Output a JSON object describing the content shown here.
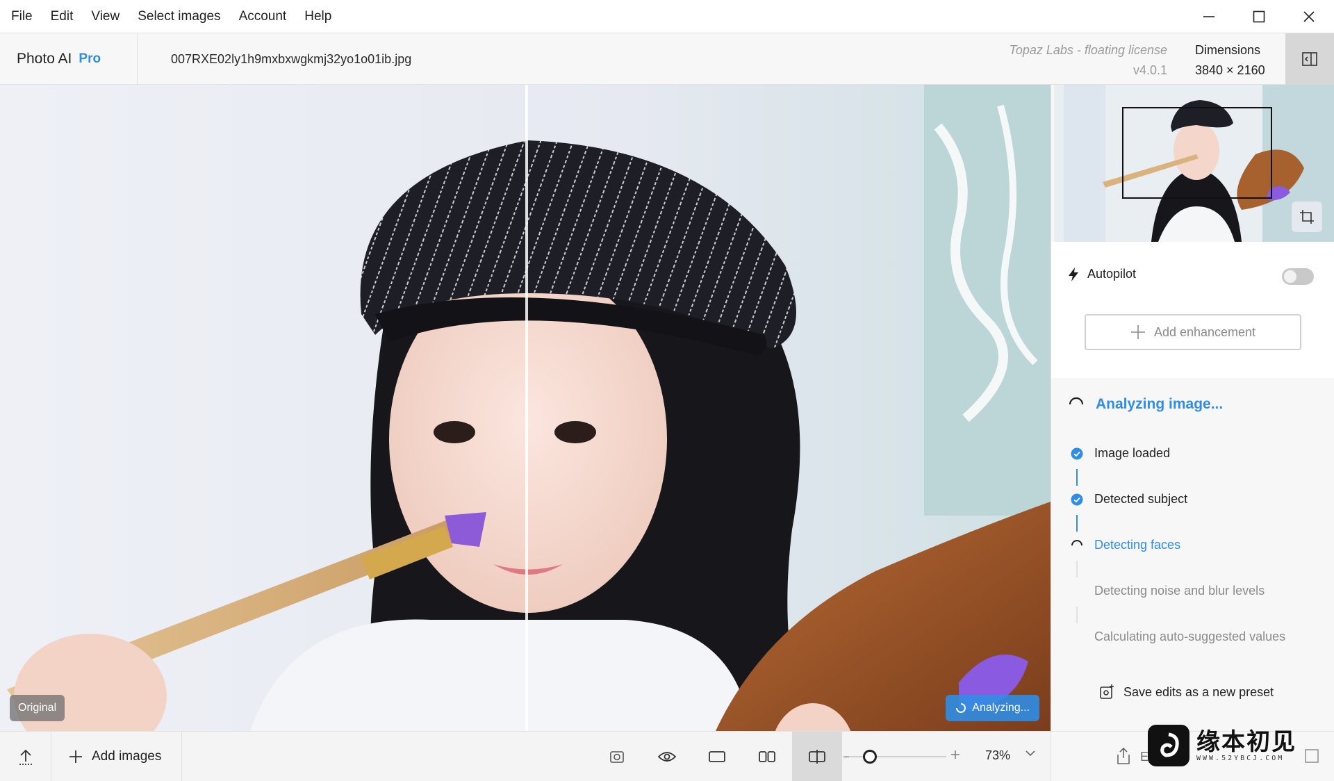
{
  "menu": [
    "File",
    "Edit",
    "View",
    "Select images",
    "Account",
    "Help"
  ],
  "header": {
    "app_name": "Photo AI",
    "edition": "Pro",
    "filename": "007RXE02ly1h9mxbxwgkmj32yo1o01ib.jpg",
    "license": "Topaz Labs - floating license",
    "version": "v4.0.1",
    "dimensions_label": "Dimensions",
    "dimensions_value": "3840 × 2160"
  },
  "canvas": {
    "original_badge": "Original",
    "analyzing_badge": "Analyzing..."
  },
  "bottombar": {
    "add_images": "Add images",
    "zoom": "73%"
  },
  "panel": {
    "autopilot": "Autopilot",
    "autopilot_on": false,
    "add_enhancement": "Add enhancement",
    "analyzing_title": "Analyzing image...",
    "steps": [
      {
        "label": "Image loaded",
        "state": "done"
      },
      {
        "label": "Detected subject",
        "state": "done"
      },
      {
        "label": "Detecting faces",
        "state": "active"
      },
      {
        "label": "Detecting noise and blur levels",
        "state": "pending"
      },
      {
        "label": "Calculating auto-suggested values",
        "state": "pending"
      }
    ],
    "save_preset": "Save edits as a new preset",
    "export_partial": "E"
  },
  "watermark": {
    "text": "缘本初见",
    "sub": "WWW.52YBCJ.COM"
  },
  "colors": {
    "accent": "#2f8de4",
    "panel_bg": "#f7f7f7",
    "toolbar_bg": "#f4f4f4"
  }
}
